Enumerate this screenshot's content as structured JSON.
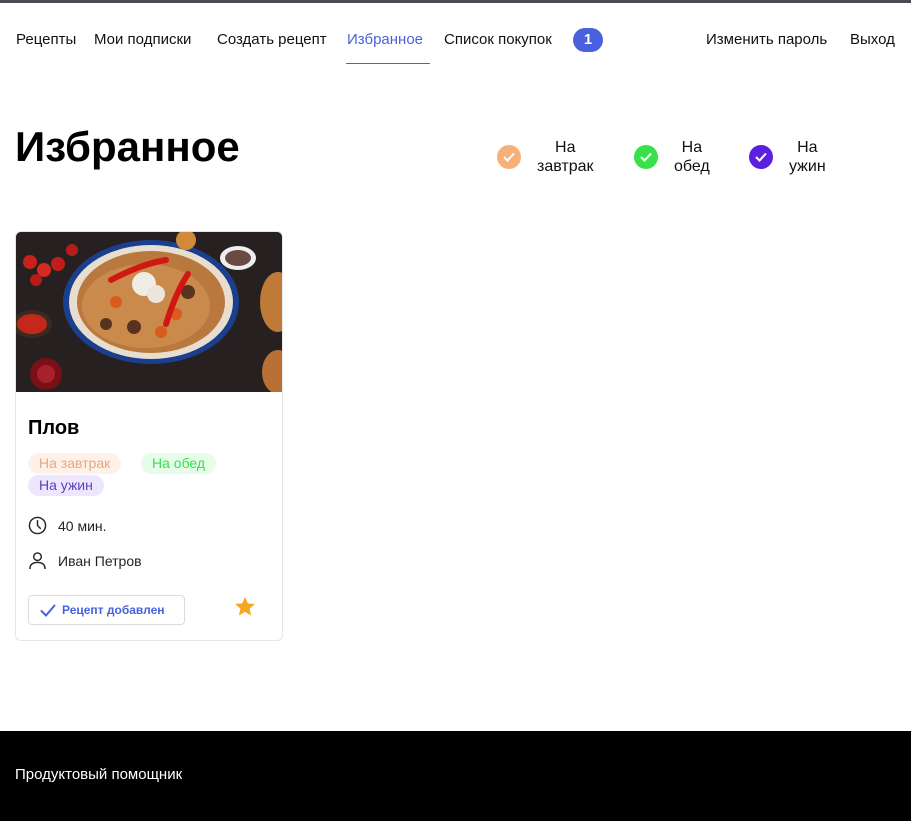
{
  "nav": {
    "items": [
      {
        "label": "Рецепты"
      },
      {
        "label": "Мои подписки"
      },
      {
        "label": "Создать рецепт"
      },
      {
        "label": "Избранное",
        "active": true
      },
      {
        "label": "Список покупок"
      }
    ],
    "cart_count": "1",
    "change_password": "Изменить пароль",
    "logout": "Выход"
  },
  "page": {
    "title": "Избранное"
  },
  "filters": [
    {
      "line1": "На",
      "line2": "завтрак",
      "color": "#f7b07a",
      "checked": true
    },
    {
      "line1": "На",
      "line2": "обед",
      "color": "#3ae04a",
      "checked": true
    },
    {
      "line1": "На",
      "line2": "ужин",
      "color": "#5a1fe0",
      "checked": true
    }
  ],
  "recipe": {
    "title": "Плов",
    "tags": [
      "На завтрак",
      "На обед",
      "На ужин"
    ],
    "time": "40 мин.",
    "author": "Иван Петров",
    "added_label": "Рецепт добавлен",
    "favorite": true,
    "icons": {
      "time": "clock-icon",
      "author": "user-icon",
      "added": "checkmark-icon",
      "favorite": "star-icon"
    }
  },
  "footer": {
    "brand": "Продуктовый помощник"
  },
  "colors": {
    "accent": "#4a61dd",
    "star": "#f5a623",
    "footer_bg": "#000000"
  }
}
